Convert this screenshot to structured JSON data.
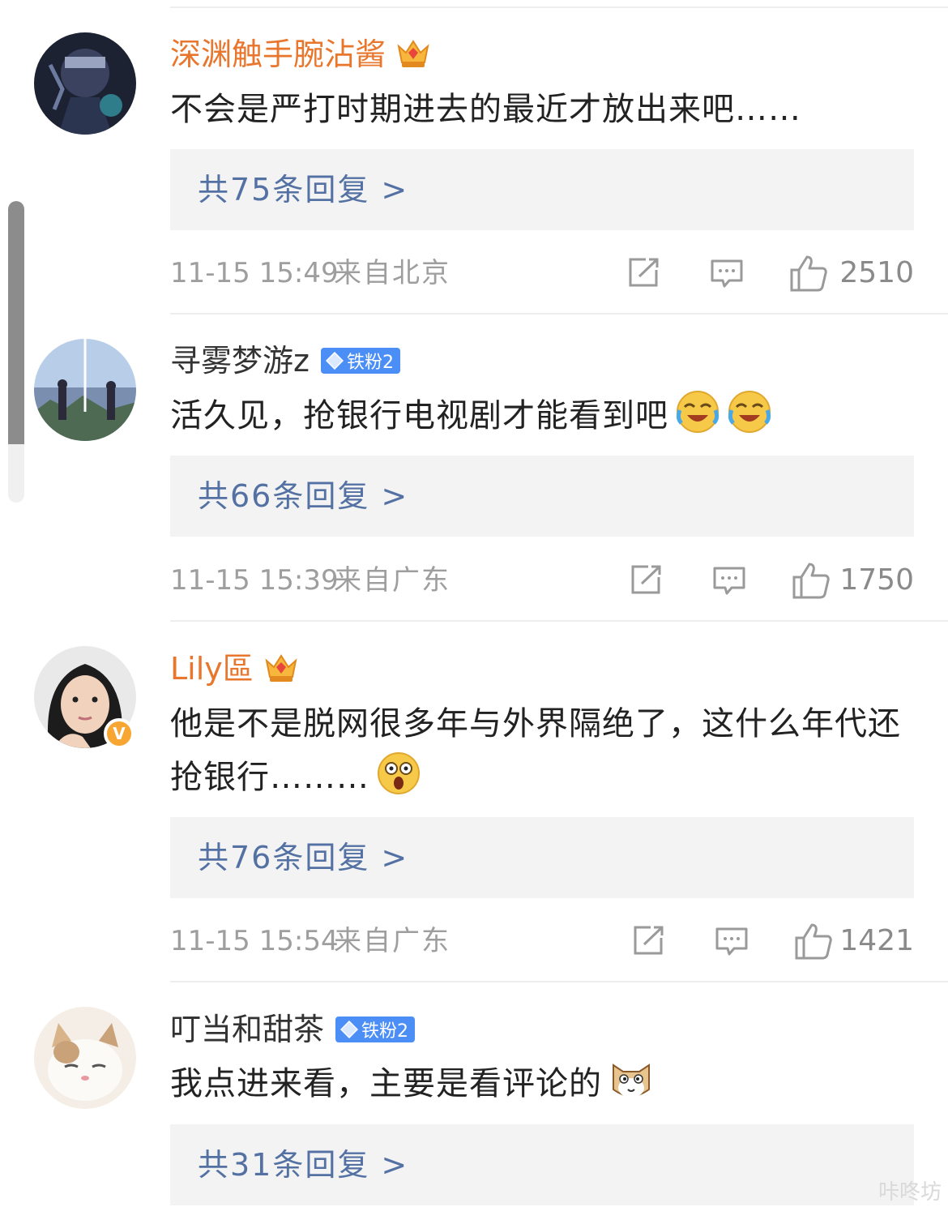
{
  "comments": [
    {
      "username": "深渊触手腕沾酱",
      "text": "不会是严打时期进去的最近才放出来吧……",
      "reply_label": "共75条回复 >",
      "time": "11-15 15:49",
      "source": "来自北京",
      "likes": "2510",
      "badge": "crown-icon"
    },
    {
      "username": "寻雾梦游z",
      "fan_badge": "铁粉2",
      "text": "活久见，抢银行电视剧才能看到吧",
      "reply_label": "共66条回复 >",
      "time": "11-15 15:39",
      "source": "来自广东",
      "likes": "1750",
      "emojis": [
        "laughing-crying-emoji",
        "laughing-crying-emoji"
      ]
    },
    {
      "username": "Lily區",
      "text": "他是不是脱网很多年与外界隔绝了，这什么年代还抢银行………",
      "reply_label": "共76条回复 >",
      "time": "11-15 15:54",
      "source": "来自广东",
      "likes": "1421",
      "verified": "V",
      "badge": "crown-icon",
      "emojis": [
        "shocked-emoji"
      ]
    },
    {
      "username": "叮当和甜茶",
      "fan_badge": "铁粉2",
      "text": "我点进来看，主要是看评论的",
      "reply_label": "共31条回复 >",
      "emojis": [
        "cat-emoji"
      ]
    }
  ],
  "watermark": "咔咚坊",
  "colors": {
    "vip_name": "#e8762c",
    "reply_link": "#5471a3",
    "fan_badge": "#4b8ef6",
    "verified": "#f7a632",
    "meta_text": "#9e9e9e"
  }
}
